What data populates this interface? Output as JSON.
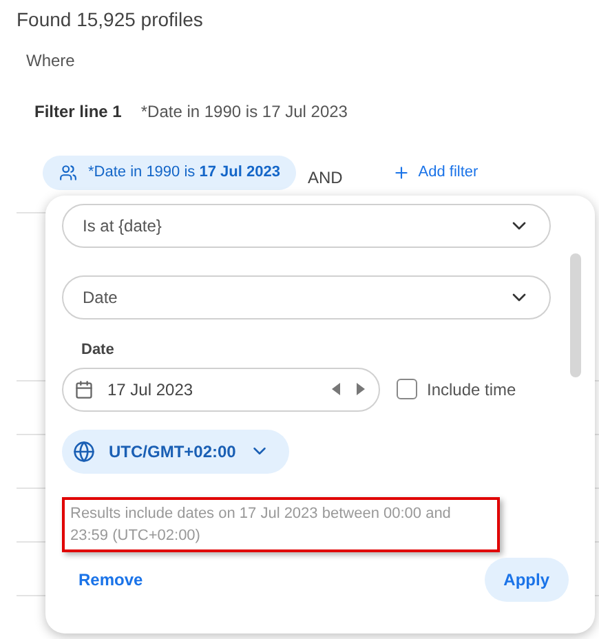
{
  "summary": "Found 15,925 profiles",
  "where_label": "Where",
  "filter_line": {
    "label": "Filter line 1",
    "value": "*Date in 1990 is 17 Jul 2023"
  },
  "filter_chip": {
    "text": "*Date in 1990 is **17 Jul 2023**"
  },
  "operator": "AND",
  "add_filter": "Add filter",
  "popup": {
    "condition_select": {
      "value": "Is at {date}"
    },
    "type_select": {
      "value": "Date"
    },
    "date_label": "Date",
    "date_field": {
      "value": "17 Jul 2023"
    },
    "include_time": {
      "label": "Include time",
      "checked": false
    },
    "timezone": {
      "value": "UTC/GMT+02:00"
    },
    "note": {
      "text": "Results include dates on 17 Jul 2023 between 00:00 and 23:59 (UTC+02:00)",
      "highlighted": true
    },
    "remove_button": "Remove",
    "apply_button": "Apply"
  }
}
